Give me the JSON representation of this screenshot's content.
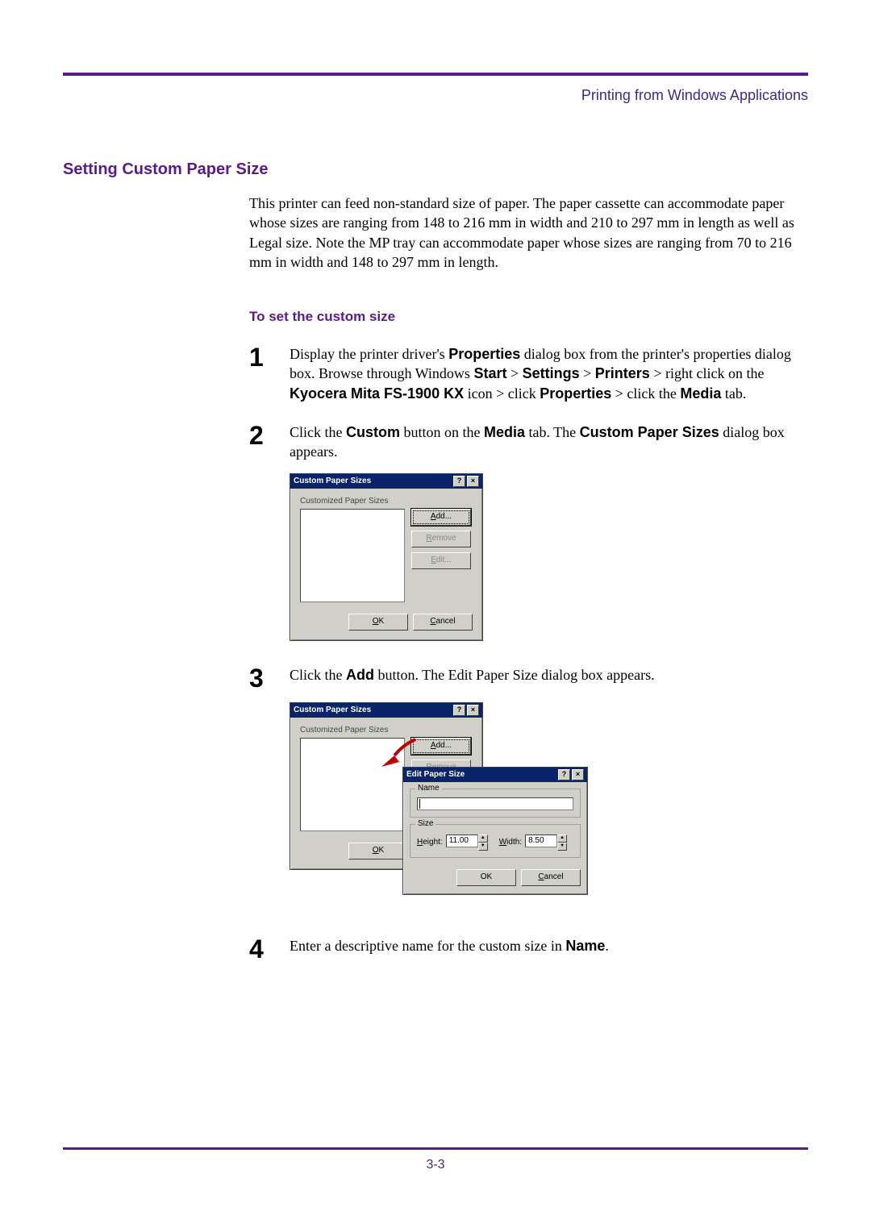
{
  "header": {
    "link": "Printing from Windows Applications"
  },
  "section_title": "Setting Custom Paper Size",
  "intro": "This printer can feed non-standard size of paper. The paper cassette can accommodate paper whose sizes are ranging from 148 to 216 mm in width and 210 to 297 mm in length as well as Legal size. Note the MP tray can accommodate paper whose sizes are ranging from 70 to 216 mm in width and 148 to 297 mm in length.",
  "sub_title": "To set the custom size",
  "steps": {
    "n1": "1",
    "t1_a": "Display the printer driver's ",
    "t1_b": " dialog box from the printer's properties dialog box. Browse through Windows ",
    "t1_start": "Start",
    "t1_sep": " > ",
    "t1_settings": "Settings",
    "t1_printers": "Printers",
    "t1_c": " > right click on the ",
    "t1_model": "Kyocera Mita FS-1900 KX",
    "t1_d": " icon > click ",
    "t1_properties": "Properties",
    "t1_e": " > click the ",
    "t1_media": "Media",
    "t1_f": " tab.",
    "n2": "2",
    "t2_a": "Click the ",
    "t2_custom": "Custom",
    "t2_b": " button on the ",
    "t2_media": "Media",
    "t2_c": " tab. The ",
    "t2_cps": "Custom Paper Sizes",
    "t2_d": " dialog box appears.",
    "n3": "3",
    "t3_a": "Click the ",
    "t3_add": "Add",
    "t3_b": " button. The Edit Paper Size dialog box appears.",
    "n4": "4",
    "t4_a": "Enter a descriptive name for the custom size in ",
    "t4_name": "Name",
    "t4_b": "."
  },
  "dlg": {
    "title": "Custom Paper Sizes",
    "group": "Customized Paper Sizes",
    "add": "Add...",
    "remove": "Remove",
    "edit": "Edit...",
    "ok": "OK",
    "cancel": "Cancel",
    "ok_u": "O",
    "cancel_u": "C",
    "add_u": "A",
    "remove_u": "R",
    "edit_u": "E",
    "help": "?",
    "close": "×"
  },
  "dlg_edit": {
    "title": "Edit Paper Size",
    "name_legend": "Name",
    "size_legend": "Size",
    "height_lbl": "Height:",
    "height_val": "11.00",
    "width_lbl": "Width:",
    "width_val": "8.50",
    "ok": "OK",
    "cancel": "Cancel"
  },
  "footer": {
    "page": "3-3"
  }
}
